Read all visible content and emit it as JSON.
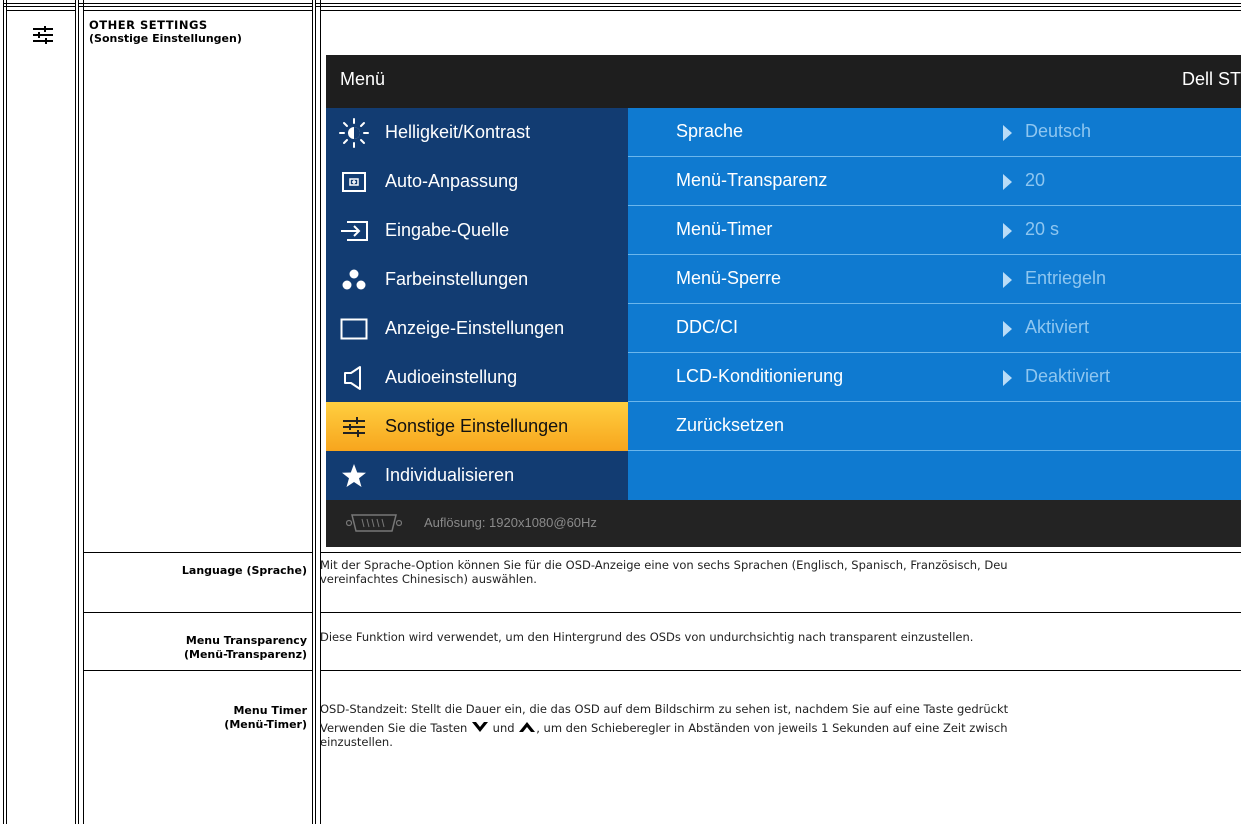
{
  "section": {
    "title": "OTHER SETTINGS",
    "subtitle": "(Sonstige Einstellungen)"
  },
  "osd": {
    "header_title": "Menü",
    "header_model": "Dell ST",
    "menu": [
      {
        "label": "Helligkeit/Kontrast",
        "icon": "brightness-icon"
      },
      {
        "label": "Auto-Anpassung",
        "icon": "auto-adjust-icon"
      },
      {
        "label": "Eingabe-Quelle",
        "icon": "input-source-icon"
      },
      {
        "label": "Farbeinstellungen",
        "icon": "color-dots-icon"
      },
      {
        "label": "Anzeige-Einstellungen",
        "icon": "display-rect-icon"
      },
      {
        "label": "Audioeinstellung",
        "icon": "speaker-icon"
      },
      {
        "label": "Sonstige Einstellungen",
        "icon": "sliders-icon",
        "active": true
      },
      {
        "label": "Individualisieren",
        "icon": "star-icon"
      }
    ],
    "options": [
      {
        "name": "Sprache",
        "value": "Deutsch"
      },
      {
        "name": "Menü-Transparenz",
        "value": "20"
      },
      {
        "name": "Menü-Timer",
        "value": "20 s"
      },
      {
        "name": "Menü-Sperre",
        "value": "Entriegeln"
      },
      {
        "name": "DDC/CI",
        "value": "Aktiviert"
      },
      {
        "name": "LCD-Konditionierung",
        "value": "Deaktiviert"
      },
      {
        "name": "Zurücksetzen",
        "value": ""
      },
      {
        "name": "",
        "value": ""
      }
    ],
    "footer_text": "Auflösung: 1920x1080@60Hz",
    "colors": {
      "left_panel": "#123c72",
      "right_panel": "#0f7ad0",
      "active": "#f7a51d"
    }
  },
  "rows": [
    {
      "label_line1": "Language (Sprache)",
      "label_line2": "",
      "desc_line1": "Mit der Sprache-Option können Sie für die OSD-Anzeige eine von sechs Sprachen (Englisch, Spanisch, Französisch, Deu",
      "desc_line2": "vereinfachtes Chinesisch) auswählen."
    },
    {
      "label_line1": "Menu Transparency",
      "label_line2": "(Menü-Transparenz)",
      "desc_line1": "Diese Funktion wird verwendet, um den Hintergrund des OSDs von undurchsichtig nach transparent einzustellen.",
      "desc_line2": ""
    },
    {
      "label_line1": "Menu Timer",
      "label_line2": "(Menü-Timer)",
      "desc_line1": "OSD-Standzeit: Stellt die Dauer ein, die das OSD auf dem Bildschirm zu sehen ist, nachdem Sie auf eine Taste gedrückt",
      "desc_line2_a": "Verwenden Sie die Tasten",
      "desc_line2_b": "und",
      "desc_line2_c": ", um den Schieberegler in Abständen von jeweils 1 Sekunden auf eine Zeit zwisch",
      "desc_line3": "einzustellen."
    }
  ]
}
